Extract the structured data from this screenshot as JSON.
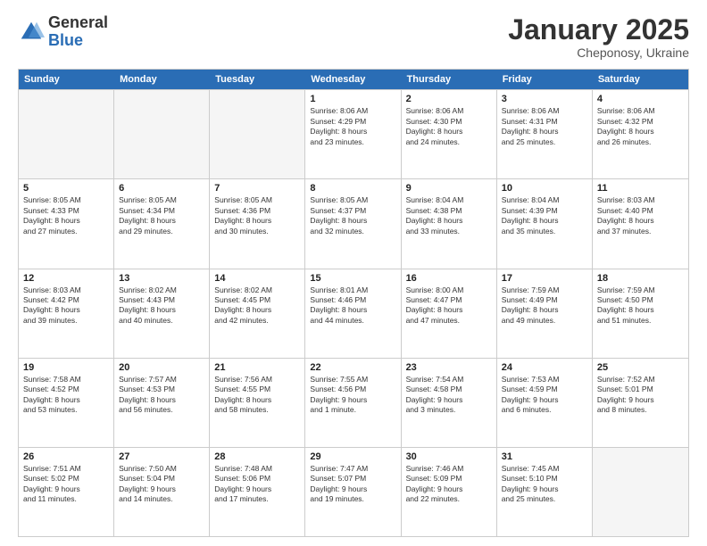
{
  "logo": {
    "general": "General",
    "blue": "Blue"
  },
  "title": "January 2025",
  "subtitle": "Cheponosy, Ukraine",
  "header_days": [
    "Sunday",
    "Monday",
    "Tuesday",
    "Wednesday",
    "Thursday",
    "Friday",
    "Saturday"
  ],
  "weeks": [
    [
      {
        "day": "",
        "info": "",
        "empty": true
      },
      {
        "day": "",
        "info": "",
        "empty": true
      },
      {
        "day": "",
        "info": "",
        "empty": true
      },
      {
        "day": "1",
        "info": "Sunrise: 8:06 AM\nSunset: 4:29 PM\nDaylight: 8 hours\nand 23 minutes."
      },
      {
        "day": "2",
        "info": "Sunrise: 8:06 AM\nSunset: 4:30 PM\nDaylight: 8 hours\nand 24 minutes."
      },
      {
        "day": "3",
        "info": "Sunrise: 8:06 AM\nSunset: 4:31 PM\nDaylight: 8 hours\nand 25 minutes."
      },
      {
        "day": "4",
        "info": "Sunrise: 8:06 AM\nSunset: 4:32 PM\nDaylight: 8 hours\nand 26 minutes."
      }
    ],
    [
      {
        "day": "5",
        "info": "Sunrise: 8:05 AM\nSunset: 4:33 PM\nDaylight: 8 hours\nand 27 minutes."
      },
      {
        "day": "6",
        "info": "Sunrise: 8:05 AM\nSunset: 4:34 PM\nDaylight: 8 hours\nand 29 minutes."
      },
      {
        "day": "7",
        "info": "Sunrise: 8:05 AM\nSunset: 4:36 PM\nDaylight: 8 hours\nand 30 minutes."
      },
      {
        "day": "8",
        "info": "Sunrise: 8:05 AM\nSunset: 4:37 PM\nDaylight: 8 hours\nand 32 minutes."
      },
      {
        "day": "9",
        "info": "Sunrise: 8:04 AM\nSunset: 4:38 PM\nDaylight: 8 hours\nand 33 minutes."
      },
      {
        "day": "10",
        "info": "Sunrise: 8:04 AM\nSunset: 4:39 PM\nDaylight: 8 hours\nand 35 minutes."
      },
      {
        "day": "11",
        "info": "Sunrise: 8:03 AM\nSunset: 4:40 PM\nDaylight: 8 hours\nand 37 minutes."
      }
    ],
    [
      {
        "day": "12",
        "info": "Sunrise: 8:03 AM\nSunset: 4:42 PM\nDaylight: 8 hours\nand 39 minutes."
      },
      {
        "day": "13",
        "info": "Sunrise: 8:02 AM\nSunset: 4:43 PM\nDaylight: 8 hours\nand 40 minutes."
      },
      {
        "day": "14",
        "info": "Sunrise: 8:02 AM\nSunset: 4:45 PM\nDaylight: 8 hours\nand 42 minutes."
      },
      {
        "day": "15",
        "info": "Sunrise: 8:01 AM\nSunset: 4:46 PM\nDaylight: 8 hours\nand 44 minutes."
      },
      {
        "day": "16",
        "info": "Sunrise: 8:00 AM\nSunset: 4:47 PM\nDaylight: 8 hours\nand 47 minutes."
      },
      {
        "day": "17",
        "info": "Sunrise: 7:59 AM\nSunset: 4:49 PM\nDaylight: 8 hours\nand 49 minutes."
      },
      {
        "day": "18",
        "info": "Sunrise: 7:59 AM\nSunset: 4:50 PM\nDaylight: 8 hours\nand 51 minutes."
      }
    ],
    [
      {
        "day": "19",
        "info": "Sunrise: 7:58 AM\nSunset: 4:52 PM\nDaylight: 8 hours\nand 53 minutes."
      },
      {
        "day": "20",
        "info": "Sunrise: 7:57 AM\nSunset: 4:53 PM\nDaylight: 8 hours\nand 56 minutes."
      },
      {
        "day": "21",
        "info": "Sunrise: 7:56 AM\nSunset: 4:55 PM\nDaylight: 8 hours\nand 58 minutes."
      },
      {
        "day": "22",
        "info": "Sunrise: 7:55 AM\nSunset: 4:56 PM\nDaylight: 9 hours\nand 1 minute."
      },
      {
        "day": "23",
        "info": "Sunrise: 7:54 AM\nSunset: 4:58 PM\nDaylight: 9 hours\nand 3 minutes."
      },
      {
        "day": "24",
        "info": "Sunrise: 7:53 AM\nSunset: 4:59 PM\nDaylight: 9 hours\nand 6 minutes."
      },
      {
        "day": "25",
        "info": "Sunrise: 7:52 AM\nSunset: 5:01 PM\nDaylight: 9 hours\nand 8 minutes."
      }
    ],
    [
      {
        "day": "26",
        "info": "Sunrise: 7:51 AM\nSunset: 5:02 PM\nDaylight: 9 hours\nand 11 minutes."
      },
      {
        "day": "27",
        "info": "Sunrise: 7:50 AM\nSunset: 5:04 PM\nDaylight: 9 hours\nand 14 minutes."
      },
      {
        "day": "28",
        "info": "Sunrise: 7:48 AM\nSunset: 5:06 PM\nDaylight: 9 hours\nand 17 minutes."
      },
      {
        "day": "29",
        "info": "Sunrise: 7:47 AM\nSunset: 5:07 PM\nDaylight: 9 hours\nand 19 minutes."
      },
      {
        "day": "30",
        "info": "Sunrise: 7:46 AM\nSunset: 5:09 PM\nDaylight: 9 hours\nand 22 minutes."
      },
      {
        "day": "31",
        "info": "Sunrise: 7:45 AM\nSunset: 5:10 PM\nDaylight: 9 hours\nand 25 minutes."
      },
      {
        "day": "",
        "info": "",
        "empty": true
      }
    ]
  ]
}
